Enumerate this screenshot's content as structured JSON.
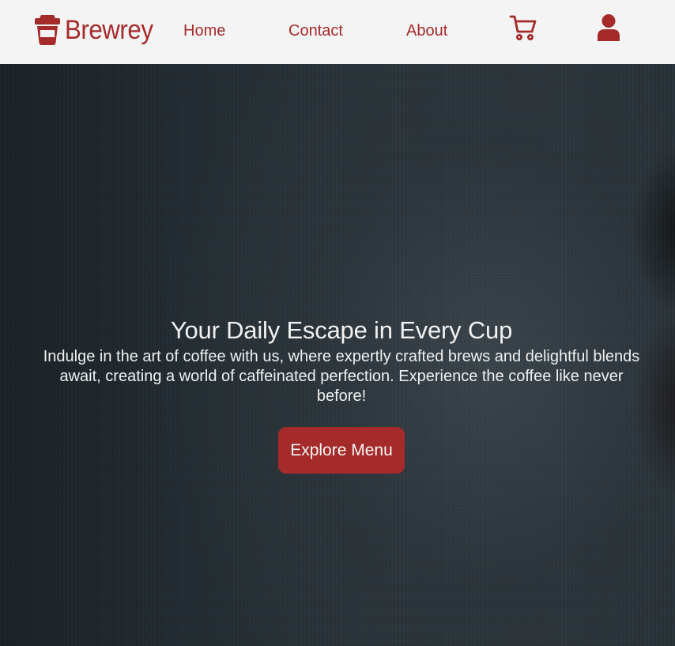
{
  "colors": {
    "accent": "#a52a2a",
    "navbar_bg": "#f4f4f4",
    "hero_text": "#f1f1f1"
  },
  "navbar": {
    "brand": {
      "icon": "coffee-cup-icon",
      "name": "Brewrey"
    },
    "links": [
      {
        "label": "Home"
      },
      {
        "label": "Contact"
      },
      {
        "label": "About"
      }
    ],
    "icons": {
      "cart": "cart-icon",
      "user": "user-icon"
    }
  },
  "hero": {
    "title": "Your Daily Escape in Every Cup",
    "subtitle": "Indulge in the art of coffee with us, where expertly crafted brews and delightful blends await, creating a world of caffeinated perfection. Experience the coffee like never before!",
    "cta_label": "Explore Menu"
  }
}
